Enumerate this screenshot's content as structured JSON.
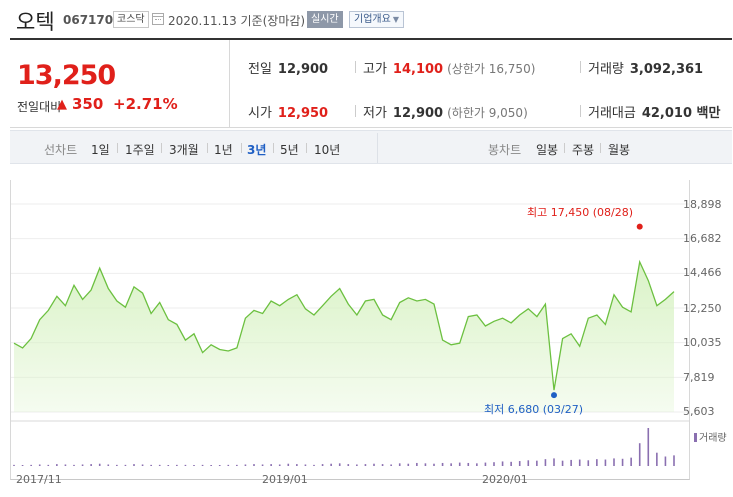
{
  "header": {
    "name": "오텍",
    "code": "067170",
    "market": "코스닥",
    "date": "2020.11.13  기준(장마감)",
    "realtime_label": "실시간",
    "overview_label": "기업개요"
  },
  "quote": {
    "price": "13,250",
    "change_label": "전일대비",
    "change_amount": "350",
    "change_rate": "+2.71%",
    "prev_close_label": "전일",
    "prev_close": "12,900",
    "high_label": "고가",
    "high": "14,100",
    "upper_limit": "(상한가 16,750)",
    "volume_label": "거래량",
    "volume": "3,092,361",
    "open_label": "시가",
    "open": "12,950",
    "low_label": "저가",
    "low": "12,900",
    "lower_limit": "(하한가 9,050)",
    "amount_label": "거래대금",
    "amount": "42,010 백만"
  },
  "tabs": {
    "line_label": "선차트",
    "line_tabs": [
      "1일",
      "1주일",
      "3개월",
      "1년",
      "3년",
      "5년",
      "10년"
    ],
    "active_line_tab": "3년",
    "candle_label": "봉차트",
    "candle_tabs": [
      "일봉",
      "주봉",
      "월봉"
    ]
  },
  "colors": {
    "up": "#e0201a",
    "line": "#6cc040",
    "fill": "#d8f2c4",
    "low_marker": "#1f5fc4",
    "volume": "#8a6fb0"
  },
  "chart_data": {
    "type": "area",
    "y_ticks": [
      "18,898",
      "16,682",
      "14,466",
      "12,250",
      "10,035",
      "7,819",
      "5,603"
    ],
    "y_tick_values": [
      18898,
      16682,
      14466,
      12250,
      10035,
      7819,
      5603
    ],
    "ylim": [
      5603,
      18898
    ],
    "x_ticks": [
      "2017/11",
      "2019/01",
      "2020/01"
    ],
    "x": [
      "2017/11",
      "2017/11",
      "2017/12",
      "2017/12",
      "2018/01",
      "2018/01",
      "2018/01",
      "2018/02",
      "2018/02",
      "2018/03",
      "2018/03",
      "2018/04",
      "2018/04",
      "2018/05",
      "2018/05",
      "2018/05",
      "2018/06",
      "2018/06",
      "2018/07",
      "2018/07",
      "2018/08",
      "2018/08",
      "2018/08",
      "2018/09",
      "2018/09",
      "2018/10",
      "2018/10",
      "2018/11",
      "2018/11",
      "2018/11",
      "2018/12",
      "2018/12",
      "2019/01",
      "2019/01",
      "2019/02",
      "2019/02",
      "2019/03",
      "2019/03",
      "2019/04",
      "2019/04",
      "2019/05",
      "2019/05",
      "2019/06",
      "2019/06",
      "2019/07",
      "2019/07",
      "2019/08",
      "2019/08",
      "2019/09",
      "2019/09",
      "2019/10",
      "2019/10",
      "2019/11",
      "2019/11",
      "2019/12",
      "2019/12",
      "2020/01",
      "2020/01",
      "2020/02",
      "2020/02",
      "2020/03",
      "2020/03",
      "2020/04",
      "2020/04",
      "2020/05",
      "2020/05",
      "2020/06",
      "2020/06",
      "2020/07",
      "2020/07",
      "2020/08",
      "2020/08",
      "2020/08",
      "2020/09",
      "2020/09",
      "2020/10",
      "2020/10",
      "2020/11"
    ],
    "values": [
      10000,
      9700,
      10300,
      11500,
      12100,
      13000,
      12400,
      13700,
      12800,
      13400,
      14800,
      13500,
      12700,
      12300,
      13600,
      13200,
      11900,
      12600,
      11500,
      11200,
      10200,
      10600,
      9400,
      9900,
      9600,
      9500,
      9700,
      11600,
      12100,
      11900,
      12700,
      12400,
      12800,
      13100,
      12200,
      11800,
      12400,
      13000,
      13500,
      12500,
      11800,
      12700,
      12800,
      11800,
      11500,
      12600,
      12900,
      12700,
      12800,
      12500,
      10200,
      9900,
      10000,
      11700,
      11800,
      11100,
      11400,
      11600,
      11300,
      11800,
      12200,
      11700,
      12500,
      7000,
      10300,
      10600,
      9800,
      11600,
      11800,
      11200,
      13100,
      12300,
      12000,
      15200,
      14000,
      12400,
      12800,
      13300
    ],
    "high": {
      "label": "최고 17,450 (08/28)",
      "value": 17450
    },
    "low": {
      "label": "최저 6,680 (03/27)",
      "value": 6680
    },
    "volume_label": "거래량",
    "volume_values": [
      0.03,
      0.02,
      0.03,
      0.04,
      0.03,
      0.05,
      0.04,
      0.03,
      0.04,
      0.05,
      0.06,
      0.04,
      0.03,
      0.03,
      0.05,
      0.04,
      0.03,
      0.03,
      0.02,
      0.03,
      0.03,
      0.02,
      0.03,
      0.02,
      0.02,
      0.03,
      0.03,
      0.04,
      0.05,
      0.04,
      0.05,
      0.04,
      0.06,
      0.05,
      0.04,
      0.03,
      0.05,
      0.06,
      0.07,
      0.05,
      0.04,
      0.05,
      0.06,
      0.05,
      0.04,
      0.07,
      0.06,
      0.08,
      0.07,
      0.06,
      0.08,
      0.07,
      0.09,
      0.08,
      0.07,
      0.09,
      0.1,
      0.12,
      0.11,
      0.13,
      0.15,
      0.14,
      0.18,
      0.2,
      0.14,
      0.16,
      0.17,
      0.15,
      0.18,
      0.17,
      0.2,
      0.19,
      0.22,
      0.6,
      1.0,
      0.35,
      0.25,
      0.28
    ]
  }
}
